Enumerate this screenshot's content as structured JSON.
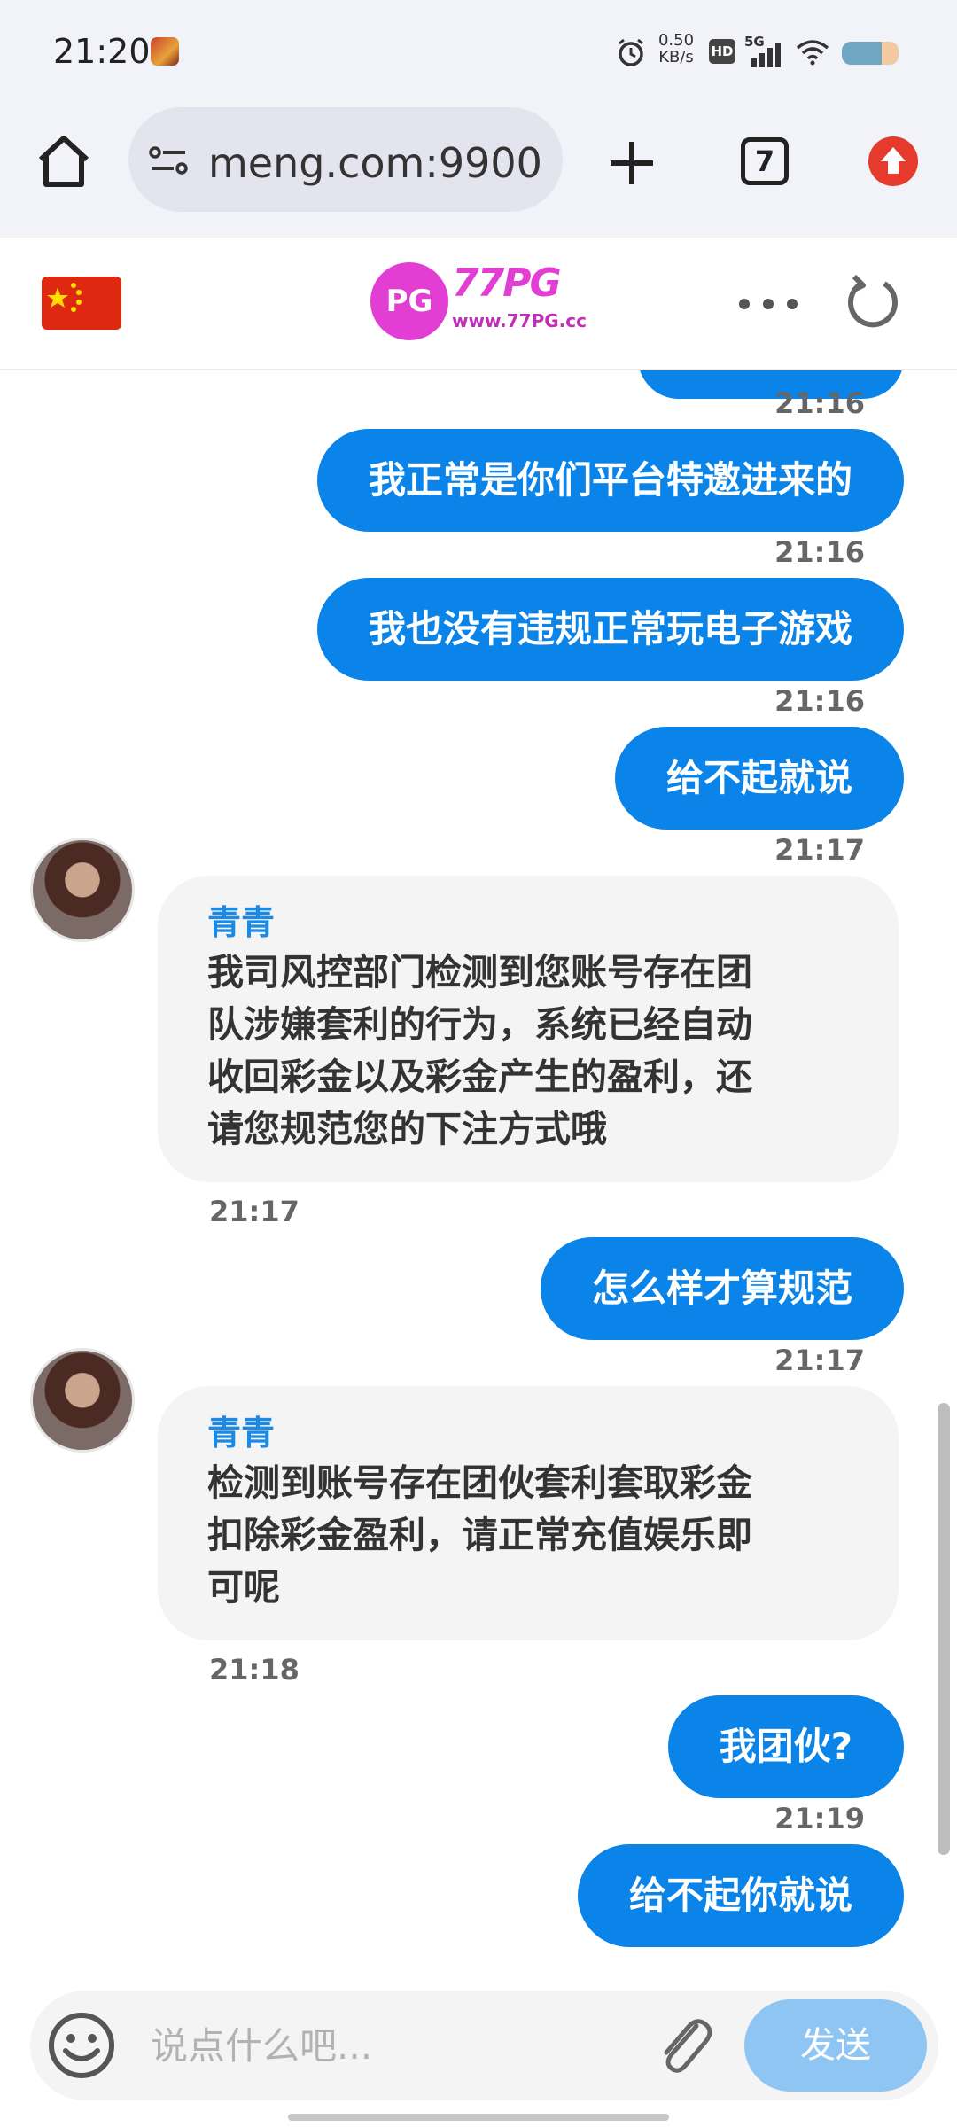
{
  "status_bar": {
    "time": "21:20",
    "net_speed_value": "0.50",
    "net_speed_unit": "KB/s",
    "hd_label": "HD",
    "signal_label": "5G"
  },
  "browser": {
    "url": "meng.com:9900",
    "tab_count": "7"
  },
  "site": {
    "logo_badge": "PG",
    "logo_name": "77PG",
    "logo_url": "www.77PG.cc"
  },
  "chat": {
    "messages": [
      {
        "dir": "out",
        "time": "21:16"
      },
      {
        "dir": "out",
        "text": "我正常是你们平台特邀进来的",
        "time": "21:16"
      },
      {
        "dir": "out",
        "text": "我也没有违规正常玩电子游戏",
        "time": "21:16"
      },
      {
        "dir": "out",
        "text": "给不起就说",
        "time": "21:17"
      },
      {
        "dir": "in",
        "sender": "青青",
        "lines": [
          "我司风控部门检测到您账号存在团",
          "队涉嫌套利的行为，系统已经自动",
          "收回彩金以及彩金产生的盈利，还",
          "请您规范您的下注方式哦"
        ],
        "time": "21:17"
      },
      {
        "dir": "out",
        "text": "怎么样才算规范",
        "time": "21:17"
      },
      {
        "dir": "in",
        "sender": "青青",
        "lines": [
          "检测到账号存在团伙套利套取彩金",
          "扣除彩金盈利，请正常充值娱乐即",
          "可呢"
        ],
        "time": "21:18"
      },
      {
        "dir": "out",
        "text": "我团伙?",
        "time": "21:19"
      },
      {
        "dir": "out",
        "text": "给不起你就说"
      }
    ]
  },
  "composer": {
    "placeholder": "说点什么吧...",
    "value": "",
    "send_label": "发送"
  },
  "colors": {
    "outgoing_bubble": "#0a84e8",
    "incoming_bubble": "#f4f4f5",
    "sender_name": "#1a8ae6",
    "send_button": "#8fc5f3",
    "toolbar_bg": "#f2f2f9"
  },
  "icons": [
    "alarm-icon",
    "wifi-icon",
    "battery-icon",
    "home-icon",
    "site-info-icon",
    "plus-icon",
    "tabs-icon",
    "update-icon",
    "china-flag-icon",
    "more-icon",
    "reload-icon",
    "emoji-icon",
    "attach-icon"
  ]
}
